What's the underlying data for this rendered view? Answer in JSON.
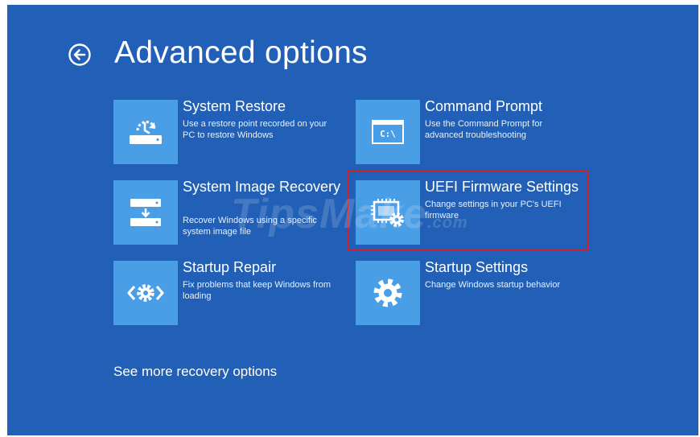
{
  "header": {
    "title": "Advanced options",
    "back_icon": "back-arrow-circle-icon"
  },
  "options": [
    {
      "id": "system-restore",
      "title": "System Restore",
      "description": "Use a restore point recorded on your PC to restore Windows",
      "icon": "restore-drive-icon"
    },
    {
      "id": "command-prompt",
      "title": "Command Prompt",
      "description": "Use the Command Prompt for advanced troubleshooting",
      "icon": "command-prompt-icon"
    },
    {
      "id": "system-image-recovery",
      "title": "System Image Recovery",
      "description": "Recover Windows using a specific system image file",
      "icon": "image-drive-icon"
    },
    {
      "id": "uefi-firmware-settings",
      "title": "UEFI Firmware Settings",
      "description": "Change settings in your PC's UEFI firmware",
      "icon": "firmware-chip-gear-icon"
    },
    {
      "id": "startup-repair",
      "title": "Startup Repair",
      "description": "Fix problems that keep Windows from loading",
      "icon": "repair-gear-icon"
    },
    {
      "id": "startup-settings",
      "title": "Startup Settings",
      "description": "Change Windows startup behavior",
      "icon": "gear-icon"
    }
  ],
  "command_prompt_icon_text": "C:\\",
  "more_options_label": "See more recovery options",
  "watermark": {
    "main": "TipsMake",
    "suffix": ".com"
  },
  "colors": {
    "background": "#2160b6",
    "tile": "#4a9ee6",
    "text": "#ffffff",
    "highlight_border": "#d0202a"
  }
}
